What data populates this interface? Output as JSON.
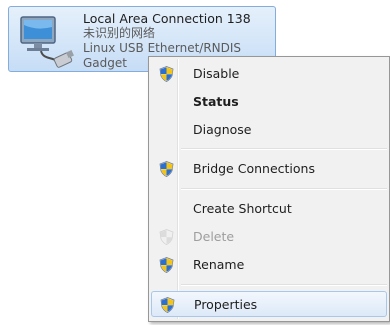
{
  "connection": {
    "name": "Local Area Connection 138",
    "status": "未识别的网络",
    "device": "Linux USB Ethernet/RNDIS Gadget"
  },
  "menu": {
    "items": [
      {
        "label": "Disable",
        "icon": "uac-shield-icon"
      },
      {
        "label": "Status",
        "style": "bold"
      },
      {
        "label": "Diagnose"
      },
      {
        "label": "Bridge Connections",
        "icon": "uac-shield-icon"
      },
      {
        "label": "Create Shortcut"
      },
      {
        "label": "Delete",
        "icon": "uac-shield-icon",
        "state": "disabled"
      },
      {
        "label": "Rename",
        "icon": "uac-shield-icon"
      },
      {
        "label": "Properties",
        "icon": "uac-shield-icon",
        "state": "highlighted"
      }
    ]
  },
  "colors": {
    "selection_fill": "#dde9f8",
    "selection_border": "#a8c7ec",
    "menu_background": "#f1f1f1",
    "disabled_text": "#9d9d9d"
  }
}
